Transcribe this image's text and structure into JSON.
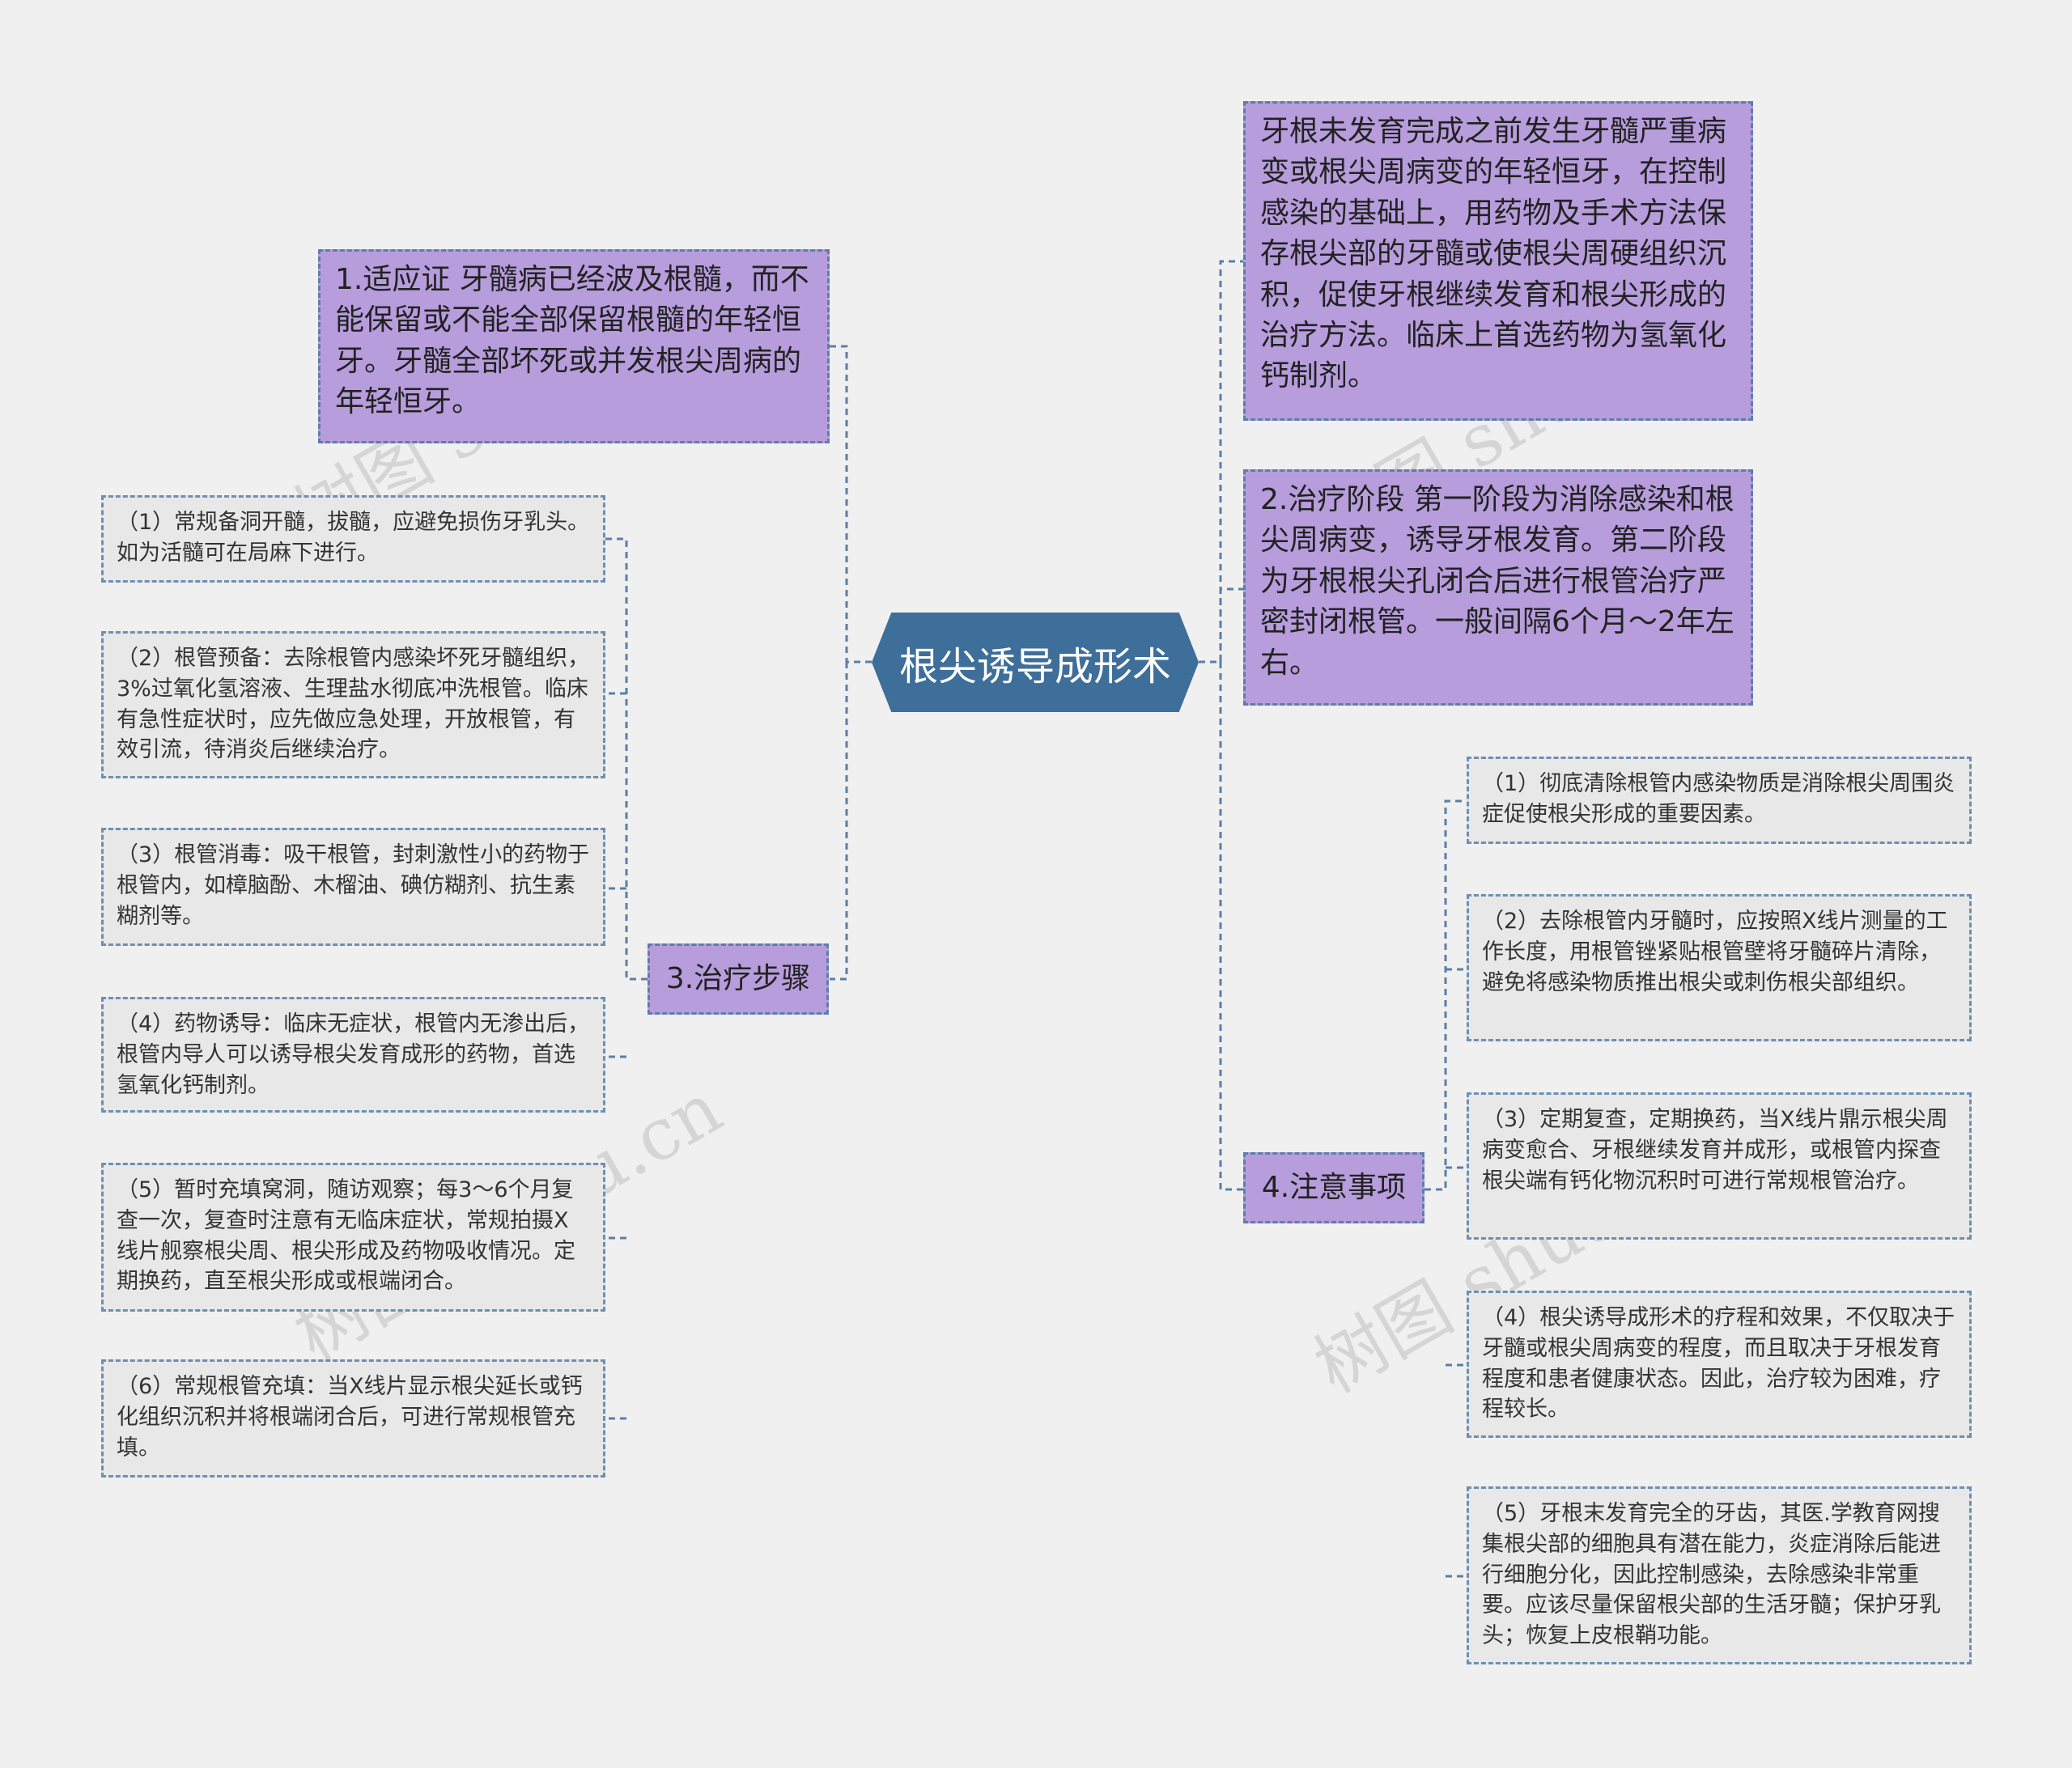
{
  "center": "根尖诱导成形术",
  "right_intro": "牙根未发育完成之前发生牙髓严重病变或根尖周病变的年轻恒牙，在控制感染的基础上，用药物及手术方法保存根尖部的牙髓或使根尖周硬组织沉积，促使牙根继续发育和根尖形成的治疗方法。临床上首选药物为氢氧化钙制剂。",
  "stage": "2.治疗阶段 第一阶段为消除感染和根尖周病变，诱导牙根发育。第二阶段为牙根根尖孔闭合后进行根管治疗严密封闭根管。一般间隔6个月～2年左右。",
  "indication": "1.适应证 牙髓病已经波及根髓，而不能保留或不能全部保留根髓的年轻恒牙。牙髓全部坏死或并发根尖周病的年轻恒牙。",
  "steps": {
    "label": "3.治疗步骤",
    "items": [
      "（1）常规备洞开髓，拔髓，应避免损伤牙乳头。如为活髓可在局麻下进行。",
      "（2）根管预备：去除根管内感染坏死牙髓组织，3%过氧化氢溶液、生理盐水彻底冲洗根管。临床有急性症状时，应先做应急处理，开放根管，有效引流，待消炎后继续治疗。",
      "（3）根管消毒：吸干根管，封刺激性小的药物于根管内，如樟脑酚、木榴油、碘仿糊剂、抗生素糊剂等。",
      "（4）药物诱导：临床无症状，根管内无渗出后，根管内导人可以诱导根尖发育成形的药物，首选氢氧化钙制剂。",
      "（5）暂时充填窝洞，随访观察；每3～6个月复查一次，复查时注意有无临床症状，常规拍摄X线片舰察根尖周、根尖形成及药物吸收情况。定期换药，直至根尖形成或根端闭合。",
      "（6）常规根管充填：当X线片显示根尖延长或钙化组织沉积并将根端闭合后，可进行常规根管充填。"
    ]
  },
  "notes": {
    "label": "4.注意事项",
    "items": [
      "（1）彻底清除根管内感染物质是消除根尖周围炎症促使根尖形成的重要因素。",
      "（2）去除根管内牙髓时，应按照X线片测量的工作长度，用根管锉紧贴根管壁将牙髓碎片清除，避免将感染物质推出根尖或刺伤根尖部组织。",
      "（3）定期复查，定期换药，当X线片鼎示根尖周病变愈合、牙根继续发育并成形，或根管内探查根尖端有钙化物沉积时可进行常规根管治疗。",
      "（4）根尖诱导成形术的疗程和效果，不仅取决于牙髓或根尖周病变的程度，而且取决于牙根发育程度和患者健康状态。因此，治疗较为困难，疗程较长。",
      "（5）牙根末发育完全的牙齿，其医.学教育网搜集根尖部的细胞具有潜在能力，炎症消除后能进行细胞分化，因此控制感染，去除感染非常重要。应该尽量保留根尖部的生活牙髓；保护牙乳头；恢复上皮根鞘功能。"
    ]
  },
  "watermark": "树图 shutu.cn",
  "colors": {
    "background": "#f0f0f0",
    "center_fill": "#3e6e9a",
    "purple_fill": "#b79ddc",
    "gray_fill": "#e8e8e8",
    "connector": "#5b7fa6"
  }
}
